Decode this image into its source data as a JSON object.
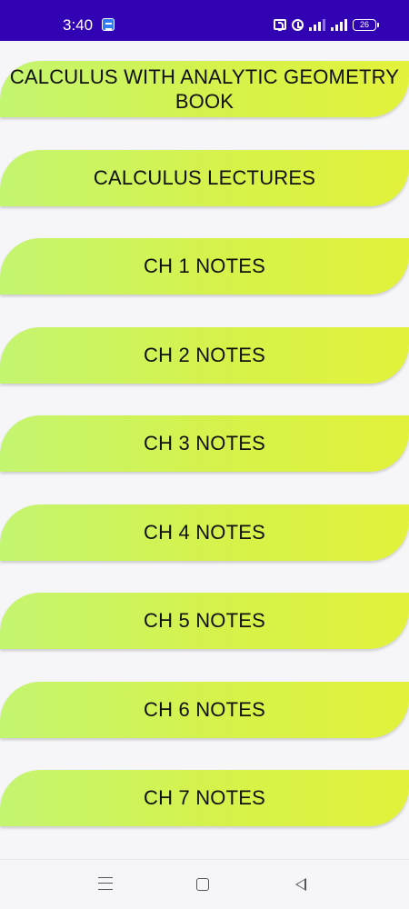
{
  "status_bar": {
    "time": "3:40",
    "battery": "26",
    "icons": [
      "app-notification-icon",
      "nfc-icon",
      "alarm-icon",
      "signal-icon",
      "signal-icon",
      "battery-icon"
    ]
  },
  "menu": {
    "items": [
      {
        "label": "CALCULUS WITH ANALYTIC GEOMETRY BOOK"
      },
      {
        "label": "CALCULUS LECTURES"
      },
      {
        "label": "CH 1 NOTES"
      },
      {
        "label": "CH 2 NOTES"
      },
      {
        "label": "CH 3 NOTES"
      },
      {
        "label": "CH 4 NOTES"
      },
      {
        "label": "CH 5 NOTES"
      },
      {
        "label": "CH 6 NOTES"
      },
      {
        "label": "CH 7 NOTES"
      }
    ]
  },
  "nav_bar": {
    "icons": [
      "menu-icon",
      "home-icon",
      "back-icon"
    ]
  },
  "colors": {
    "status_bar": "#3103b2",
    "button_gradient_start": "#c4f570",
    "button_gradient_end": "#e2f23b",
    "background": "#f6f6f8"
  }
}
